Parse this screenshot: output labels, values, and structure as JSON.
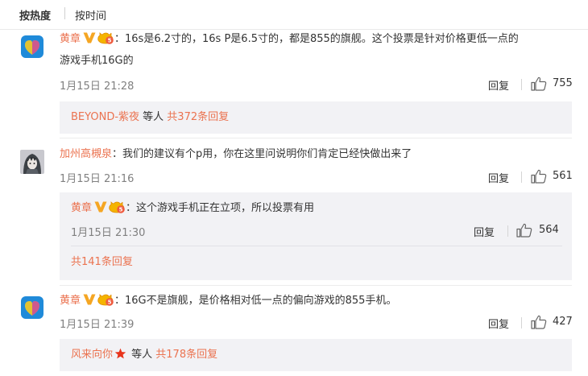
{
  "sort": {
    "hot_label": "按热度",
    "time_label": "按时间"
  },
  "comments": [
    {
      "user": "黄章",
      "text_line1": "：16s是6.2寸的，16s P是6.5寸的，都是855的旗舰。这个投票是针对价格更低一点的",
      "text_line2": "游戏手机16G的",
      "date": "1月15日 21:28",
      "reply_label": "回复",
      "likes": "755",
      "summary": {
        "users": "BEYOND-紫夜",
        "mid": " 等人 ",
        "count": "共372条回复"
      }
    },
    {
      "user": "加州高槻泉",
      "text": "：我们的建议有个p用，你在这里问说明你们肯定已经快做出来了",
      "date": "1月15日 21:16",
      "reply_label": "回复",
      "likes": "561",
      "reply": {
        "user": "黄章",
        "text": "：这个游戏手机正在立项，所以投票有用",
        "date": "1月15日 21:30",
        "reply_label": "回复",
        "likes": "564"
      },
      "summary": {
        "count": "共141条回复"
      }
    },
    {
      "user": "黄章",
      "text": "：16G不是旗舰，是价格相对低一点的偏向游戏的855手机。",
      "date": "1月15日 21:39",
      "reply_label": "回复",
      "likes": "427",
      "summary": {
        "users": "风来向你",
        "mid": " 等人 ",
        "count": "共178条回复"
      }
    }
  ],
  "colors": {
    "name": "#eb7350",
    "text": "#333333",
    "meta": "#808080",
    "graybox": "#f2f2f5",
    "vbadge": "#f5a623"
  }
}
